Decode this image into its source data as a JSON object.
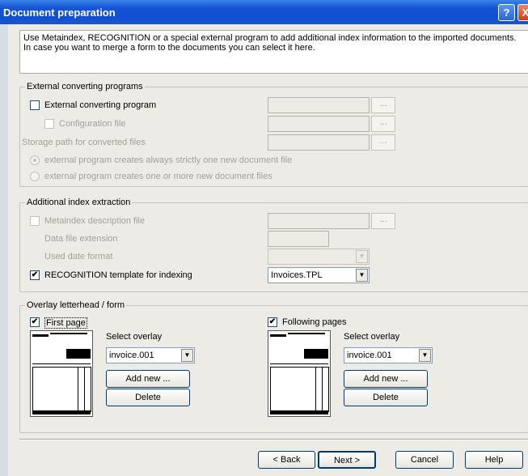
{
  "window": {
    "title": "Document preparation",
    "help_glyph": "?",
    "close_glyph": "X"
  },
  "intro_text": "Use Metaindex, RECOGNITION or a special external program to add additional index information to the imported documents. In case you want to merge a form to the documents you can select it here.",
  "external": {
    "title": "External converting programs",
    "external_program": {
      "label": "External converting program",
      "checked": ""
    },
    "config_file": {
      "label": "Configuration file",
      "checked": ""
    },
    "storage_label": "Storage path for converted files",
    "radio_one": "external program creates always strictly one new document file",
    "radio_more": "external program creates one or more new document files",
    "browse_label": "..."
  },
  "index": {
    "title": "Additional index extraction",
    "metaindex": {
      "label": "Metaindex description file",
      "checked": ""
    },
    "data_ext_label": "Data file extension",
    "date_format_label": "Used date format",
    "recognition": {
      "label": "RECOGNITION template for indexing",
      "checked": "✔",
      "value": "Invoices.TPL"
    },
    "browse_label": "..."
  },
  "overlay": {
    "title": "Overlay letterhead / form",
    "first": {
      "label": "First page",
      "checked": "✔",
      "select_label": "Select overlay",
      "value": "invoice.001",
      "add_label": "Add new ...",
      "delete_label": "Delete"
    },
    "following": {
      "label": "Following pages",
      "checked": "✔",
      "select_label": "Select overlay",
      "value": "invoice.001",
      "add_label": "Add new ...",
      "delete_label": "Delete"
    }
  },
  "footer": {
    "back": "< Back",
    "next": "Next >",
    "cancel": "Cancel",
    "help": "Help"
  },
  "icons": {
    "dropdown": "▼"
  }
}
